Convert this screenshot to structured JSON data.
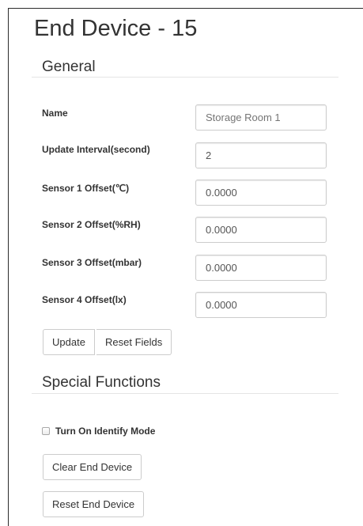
{
  "page": {
    "title": "End Device - 15"
  },
  "general": {
    "heading": "General",
    "fields": [
      {
        "label": "Name",
        "value": "",
        "placeholder": "Storage Room 1"
      },
      {
        "label": "Update Interval(second)",
        "value": "2",
        "placeholder": ""
      },
      {
        "label": "Sensor 1 Offset(℃)",
        "value": "0.0000",
        "placeholder": ""
      },
      {
        "label": "Sensor 2 Offset(%RH)",
        "value": "0.0000",
        "placeholder": ""
      },
      {
        "label": "Sensor 3 Offset(mbar)",
        "value": "0.0000",
        "placeholder": ""
      },
      {
        "label": "Sensor 4 Offset(lx)",
        "value": "0.0000",
        "placeholder": ""
      }
    ],
    "update_label": "Update",
    "reset_fields_label": "Reset Fields"
  },
  "special": {
    "heading": "Special Functions",
    "identify_label": "Turn On Identify Mode",
    "identify_checked": false,
    "clear_label": "Clear End Device",
    "reset_label": "Reset End Device"
  }
}
